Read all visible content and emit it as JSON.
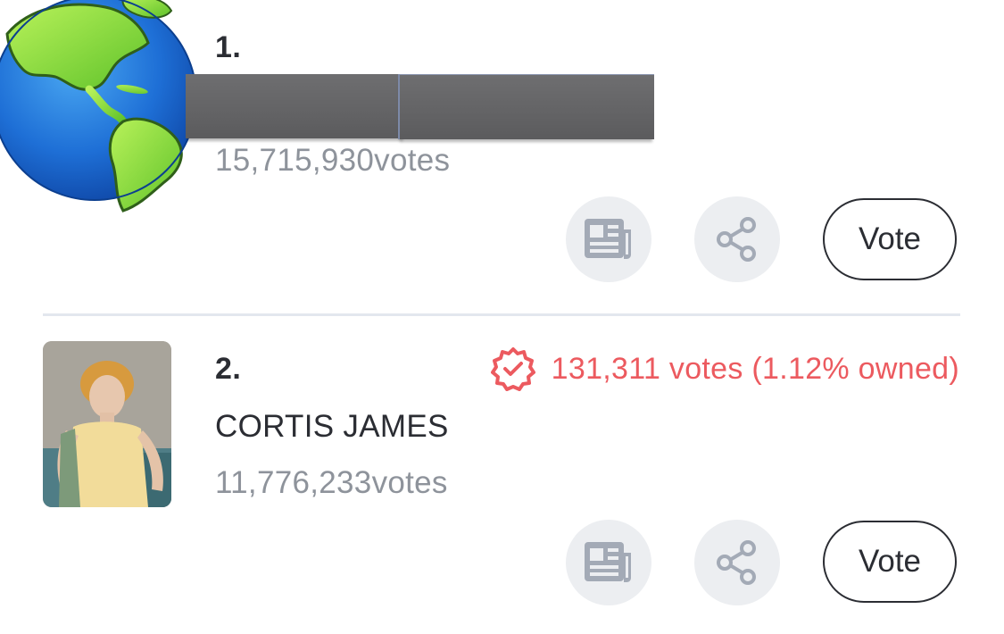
{
  "entries": [
    {
      "rank": "1.",
      "name": "",
      "votes": "15,715,930votes",
      "vote_label": "Vote"
    },
    {
      "rank": "2.",
      "name": "CORTIS JAMES",
      "votes": "11,776,233votes",
      "owned": "131,311 votes (1.12% owned)",
      "vote_label": "Vote"
    }
  ],
  "icons": {
    "globe": "globe-icon",
    "news": "newspaper-icon",
    "share": "share-icon",
    "badge": "verified-badge-icon"
  },
  "colors": {
    "accent_red": "#ec5a5f",
    "text_dark": "#2b2d33",
    "text_gray": "#8e939b",
    "icon_bg": "#eceef1",
    "icon_gray": "#a3aab6"
  }
}
